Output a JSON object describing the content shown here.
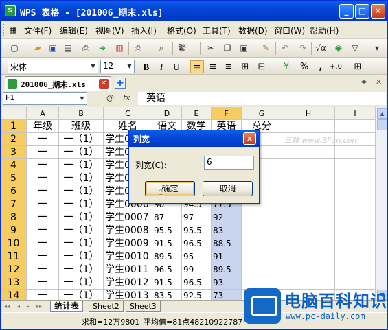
{
  "window": {
    "title": "WPS 表格 - [201006_期末.xls]",
    "app_icon": "S"
  },
  "menu": [
    "文件(F)",
    "编辑(E)",
    "视图(V)",
    "插入(I)",
    "格式(O)",
    "工具(T)",
    "数据(D)",
    "窗口(W)",
    "帮助(H)"
  ],
  "format_bar": {
    "font": "宋体",
    "size": "12",
    "bold": "B",
    "italic": "I",
    "underline": "U",
    "percent": "%",
    "comma": ","
  },
  "document_tab": {
    "name": "201006_期末.xls",
    "new_tab": "+"
  },
  "formula_bar": {
    "cell_ref": "F1",
    "content": "英语",
    "fx": "fx"
  },
  "columns": [
    "A",
    "B",
    "C",
    "D",
    "E",
    "F",
    "G",
    "H",
    "I"
  ],
  "rows": [
    {
      "n": "1",
      "a": "年级",
      "b": "班级",
      "c": "姓名",
      "d": "语文",
      "e": "数学",
      "f": "英语",
      "g": "总分"
    },
    {
      "n": "2",
      "a": "一",
      "b": "一（1）",
      "c": "学生0001",
      "d": "",
      "e": "",
      "f": "",
      "g": ""
    },
    {
      "n": "3",
      "a": "一",
      "b": "一（1）",
      "c": "学生0002",
      "d": "",
      "e": "",
      "f": "",
      "g": ""
    },
    {
      "n": "4",
      "a": "一",
      "b": "一（1）",
      "c": "学生0003",
      "d": "",
      "e": "",
      "f": "",
      "g": ""
    },
    {
      "n": "5",
      "a": "一",
      "b": "一（1）",
      "c": "学生0004",
      "d": "",
      "e": "",
      "f": "",
      "g": ""
    },
    {
      "n": "6",
      "a": "一",
      "b": "一（1）",
      "c": "学生0005",
      "d": "",
      "e": "",
      "f": "",
      "g": ""
    },
    {
      "n": "7",
      "a": "一",
      "b": "一（1）",
      "c": "学生0006",
      "d": "90",
      "e": "94.5",
      "f": "77.5",
      "g": ""
    },
    {
      "n": "8",
      "a": "一",
      "b": "一（1）",
      "c": "学生0007",
      "d": "87",
      "e": "97",
      "f": "92",
      "g": ""
    },
    {
      "n": "9",
      "a": "一",
      "b": "一（1）",
      "c": "学生0008",
      "d": "95.5",
      "e": "95.5",
      "f": "83",
      "g": ""
    },
    {
      "n": "10",
      "a": "一",
      "b": "一（1）",
      "c": "学生0009",
      "d": "91.5",
      "e": "96.5",
      "f": "88.5",
      "g": ""
    },
    {
      "n": "11",
      "a": "一",
      "b": "一（1）",
      "c": "学生0010",
      "d": "89.5",
      "e": "95",
      "f": "91",
      "g": ""
    },
    {
      "n": "12",
      "a": "一",
      "b": "一（1）",
      "c": "学生0011",
      "d": "96.5",
      "e": "99",
      "f": "89.5",
      "g": ""
    },
    {
      "n": "13",
      "a": "一",
      "b": "一（1）",
      "c": "学生0012",
      "d": "91.5",
      "e": "96.5",
      "f": "93",
      "g": ""
    },
    {
      "n": "14",
      "a": "一",
      "b": "一（1）",
      "c": "学生0013",
      "d": "83.5",
      "e": "92.5",
      "f": "73",
      "g": ""
    }
  ],
  "sheets": [
    "统计表",
    "Sheet2",
    "Sheet3"
  ],
  "status": {
    "sum": "求和=12万9801",
    "avg": "平均值=81点48210922787"
  },
  "dialog": {
    "title": "列宽",
    "label": "列宽(C):",
    "value": "6",
    "ok": "确定",
    "cancel": "取消",
    "close": "x"
  },
  "watermark": {
    "text": "三联 www.3lian.com",
    "logo_title": "电脑百科知识",
    "logo_url": "www.pc-daily.com"
  },
  "colors": {
    "titlebar": "#0446d8",
    "selected_header": "#f6cd62",
    "selected_column": "#c9d5ef",
    "logo": "#0b5fc8"
  }
}
